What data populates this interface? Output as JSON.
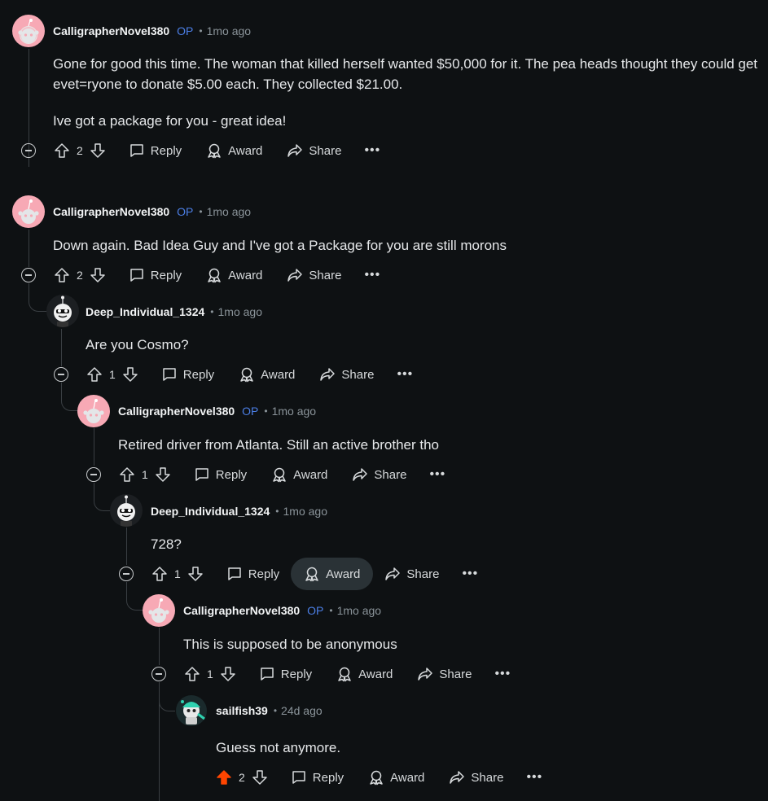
{
  "comments": [
    {
      "user": "CalligrapherNovel380",
      "op": "OP",
      "time": "1mo ago",
      "text": "Gone for good this time. The woman that killed herself wanted $50,000 for it. The pea heads thought they could get evet=ryone to donate $5.00 each. They collected $21.00.",
      "text2": "Ive got a package for you - great idea!",
      "score": "2"
    },
    {
      "user": "CalligrapherNovel380",
      "op": "OP",
      "time": "1mo ago",
      "text": "Down again. Bad Idea Guy and I've got a Package for you are still morons",
      "score": "2"
    },
    {
      "user": "Deep_Individual_1324",
      "time": "1mo ago",
      "text": "Are you Cosmo?",
      "score": "1"
    },
    {
      "user": "CalligrapherNovel380",
      "op": "OP",
      "time": "1mo ago",
      "text": "Retired driver from Atlanta. Still an active brother tho",
      "score": "1"
    },
    {
      "user": "Deep_Individual_1324",
      "time": "1mo ago",
      "text": "728?",
      "score": "1"
    },
    {
      "user": "CalligrapherNovel380",
      "op": "OP",
      "time": "1mo ago",
      "text": "This is supposed to be anonymous",
      "score": "1"
    },
    {
      "user": "sailfish39",
      "time": "24d ago",
      "text": "Guess not anymore.",
      "score": "2"
    }
  ],
  "labels": {
    "reply": "Reply",
    "award": "Award",
    "share": "Share",
    "more": "•••"
  },
  "colors": {
    "background": "#0e1113",
    "op_blue": "#4c7fe6",
    "upvoted": "#ff4500"
  }
}
